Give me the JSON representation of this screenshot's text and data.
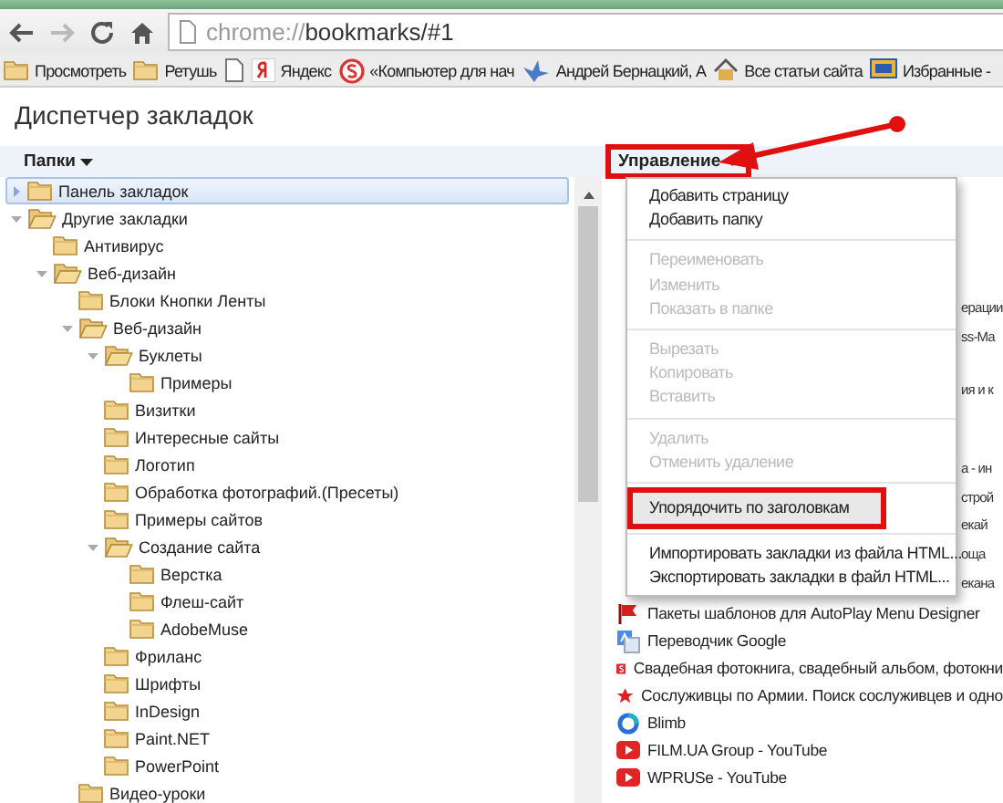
{
  "toolbar": {
    "url": "chrome://bookmarks/#1"
  },
  "bookmarks_bar": [
    {
      "label": "Просмотреть",
      "kind": "folder"
    },
    {
      "label": "Ретушь",
      "kind": "folder"
    },
    {
      "kind": "page"
    },
    {
      "label": "Яндекс",
      "kind": "yandex"
    },
    {
      "label": "«Компьютер для нач",
      "kind": "s-circle"
    },
    {
      "label": "Андрей Бернацкий, А",
      "kind": "bird"
    },
    {
      "label": "Все статьи сайта",
      "kind": "house"
    },
    {
      "label": "Избранные -",
      "kind": "monitor"
    }
  ],
  "page_title": "Диспетчер закладок",
  "folders_header": {
    "label": "Папки"
  },
  "manage_button": {
    "label": "Управление",
    "highlighted": true,
    "callout_arrow": true
  },
  "folder_tree": [
    {
      "label": "Панель закладок",
      "selected": true,
      "expanded": false
    },
    {
      "label": "Другие закладки",
      "selected": false,
      "expanded": true,
      "children": [
        {
          "label": "Антивирус",
          "selected": false
        },
        {
          "label": "Веб-дизайн",
          "selected": false,
          "expanded": true,
          "children": [
            {
              "label": "Блоки Кнопки Ленты",
              "selected": false
            },
            {
              "label": "Веб-дизайн",
              "selected": false,
              "expanded": true,
              "children": [
                {
                  "label": "Буклеты",
                  "selected": false,
                  "expanded": true,
                  "children": [
                    {
                      "label": "Примеры",
                      "selected": false
                    }
                  ]
                },
                {
                  "label": "Визитки",
                  "selected": false
                },
                {
                  "label": "Интересные сайты",
                  "selected": false
                },
                {
                  "label": "Логотип",
                  "selected": false
                },
                {
                  "label": "Обработка фотографий.(Пресеты)",
                  "selected": false
                },
                {
                  "label": "Примеры сайтов",
                  "selected": false
                },
                {
                  "label": "Создание сайта",
                  "selected": false,
                  "expanded": true,
                  "children": [
                    {
                      "label": "Верстка",
                      "selected": false
                    },
                    {
                      "label": "Флеш-сайт",
                      "selected": false
                    },
                    {
                      "label": "AdobeMuse",
                      "selected": false
                    }
                  ]
                },
                {
                  "label": "Фриланс",
                  "selected": false
                },
                {
                  "label": "Шрифты",
                  "selected": false
                },
                {
                  "label": "InDesign",
                  "selected": false
                },
                {
                  "label": "Paint.NET",
                  "selected": false
                },
                {
                  "label": "PowerPoint",
                  "selected": false
                }
              ]
            },
            {
              "label": "Видео-уроки",
              "selected": false
            }
          ]
        }
      ]
    }
  ],
  "manage_menu": [
    [
      {
        "label": "Добавить страницу",
        "disabled": false,
        "highlighted": false
      },
      {
        "label": "Добавить папку",
        "disabled": false,
        "highlighted": false
      }
    ],
    [
      {
        "label": "Переименовать",
        "disabled": true,
        "highlighted": false
      },
      {
        "label": "Изменить",
        "disabled": true,
        "highlighted": false
      },
      {
        "label": "Показать в папке",
        "disabled": true,
        "highlighted": false
      }
    ],
    [
      {
        "label": "Вырезать",
        "disabled": true,
        "highlighted": false
      },
      {
        "label": "Копировать",
        "disabled": true,
        "highlighted": false
      },
      {
        "label": "Вставить",
        "disabled": true,
        "highlighted": false
      }
    ],
    [
      {
        "label": "Удалить",
        "disabled": true,
        "highlighted": false
      },
      {
        "label": "Отменить удаление",
        "disabled": true,
        "highlighted": false
      }
    ],
    [
      {
        "label": "Упорядочить по заголовкам",
        "disabled": false,
        "highlighted": true
      }
    ],
    [
      {
        "label": "Импортировать закладки из файла HTML...",
        "disabled": false,
        "highlighted": false
      },
      {
        "label": "Экспортировать закладки в файл HTML...",
        "disabled": false,
        "highlighted": false
      }
    ]
  ],
  "bookmarks_list": {
    "cut_texts": [
      "ерации",
      "ss-Ma",
      "ия и к",
      "а - ин",
      "строй",
      "екай",
      "оща",
      "екана"
    ],
    "rows": [
      {
        "label": "Пакеты шаблонов для AutoPlay Menu Designer",
        "kind": "flag"
      },
      {
        "label": "Переводчик Google",
        "kind": "translate"
      },
      {
        "label": "Свадебная фотокнига, свадебный альбом, фотокни",
        "kind": "s-square"
      },
      {
        "label": "Сослуживцы по Армии. Поиск сослуживцев и одно",
        "kind": "star"
      },
      {
        "label": "Blimb",
        "kind": "ring"
      },
      {
        "label": "FILM.UA Group - YouTube",
        "kind": "play"
      },
      {
        "label": "WPRUSe - YouTube",
        "kind": "play"
      }
    ]
  }
}
